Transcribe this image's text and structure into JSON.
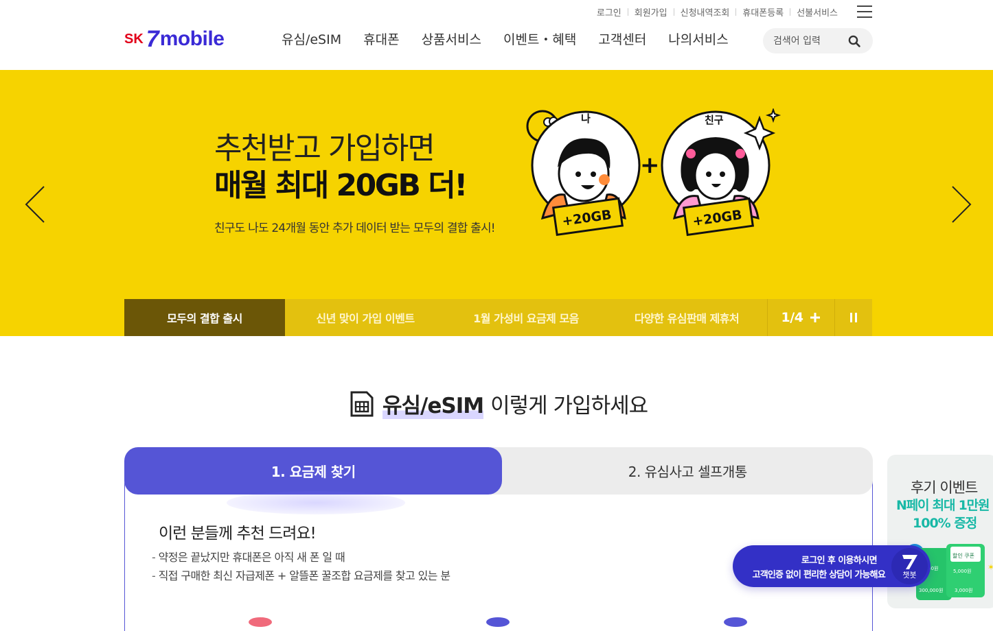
{
  "header": {
    "util_links": [
      "로그인",
      "회원가입",
      "신청내역조회",
      "휴대폰등록",
      "선불서비스"
    ],
    "logo": {
      "brand": "SK",
      "mark": "7",
      "name": "mobile"
    },
    "nav": [
      "유심/eSIM",
      "휴대폰",
      "상품서비스",
      "이벤트・혜택",
      "고객센터",
      "나의서비스"
    ],
    "search": {
      "placeholder": "검색어 입력",
      "icon": "search-icon"
    }
  },
  "hero": {
    "line1": "추천받고 가입하면",
    "line2": "매월 최대 20GB 더!",
    "sub": "친구도 나도 24개월 동안 추가 데이터 받는 모두의 결합 출시!",
    "illustration": {
      "me_label": "나",
      "friend_label": "친구",
      "plus": "+",
      "ticket_left": "+20GB",
      "ticket_right": "+20GB"
    },
    "tabs": [
      {
        "label": "모두의 결합 출시",
        "active": true
      },
      {
        "label": "신년 맞이 가입 이벤트",
        "active": false
      },
      {
        "label": "1월 가성비 요금제 모음",
        "active": false
      },
      {
        "label": "다양한 유심판매 제휴처",
        "active": false
      }
    ],
    "pager": "1/4",
    "colors": {
      "bg": "#f6d300",
      "active_tab": "#6b5607"
    }
  },
  "section": {
    "title_highlight": "유심/eSIM",
    "title_rest": "이렇게 가입하세요",
    "steps": [
      {
        "label": "1. 요금제 찾기",
        "active": true
      },
      {
        "label": "2. 유심사고 셀프개통",
        "active": false
      }
    ],
    "recommend_title": "이런 분들께 추천 드려요!",
    "recommend_items": [
      "약정은 끝났지만 휴대폰은 아직 새 폰 일 때",
      "직접 구매한 최신 자급제폰 + 알뜰폰 꿀조합 요금제를 찾고 있는 분"
    ],
    "accent_color": "#5555d6"
  },
  "side_banner": {
    "line1": "후기 이벤트",
    "line2": "N페이 최대 1만원",
    "line3": "100% 증정",
    "coupon_top": "할인 쿠폰",
    "amounts": [
      "5,000원",
      "5,000원",
      "300,000원",
      "3,000원"
    ]
  },
  "chatbot": {
    "message1": "로그인 후 이용하시면",
    "message2": "고객인증 없이 편리한 상담이 가능해요",
    "label": "챗봇"
  }
}
